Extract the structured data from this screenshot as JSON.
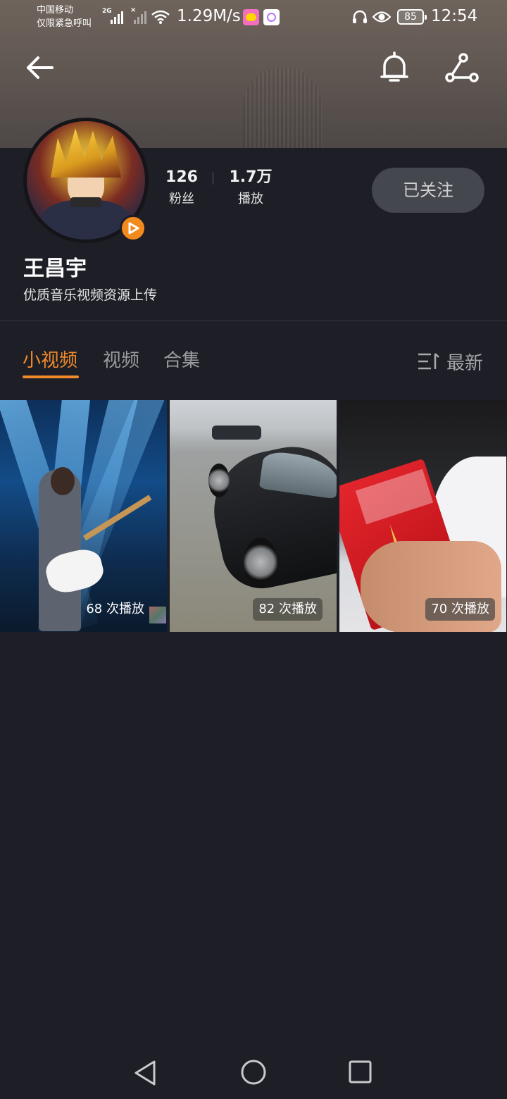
{
  "status_bar": {
    "carrier_line1": "中国移动",
    "carrier_line2": "仅限紧急呼叫",
    "network": "2G",
    "net_speed": "1.29M/s",
    "battery": "85",
    "time": "12:54"
  },
  "profile": {
    "fans_count": "126",
    "fans_label": "粉丝",
    "plays_count": "1.7万",
    "plays_label": "播放",
    "follow_button": "已关注",
    "username": "王昌宇",
    "bio": "优质音乐视频资源上传"
  },
  "tabs": [
    {
      "label": "小视频",
      "active": true
    },
    {
      "label": "视频",
      "active": false
    },
    {
      "label": "合集",
      "active": false
    }
  ],
  "sort": {
    "label": "最新"
  },
  "videos": [
    {
      "plays": "68 次播放"
    },
    {
      "plays": "82 次播放"
    },
    {
      "plays": "70 次播放"
    }
  ],
  "colors": {
    "accent": "#f08a2a",
    "background": "#1d1e26",
    "button_bg": "#45474f"
  },
  "icons": [
    "back-arrow-icon",
    "bell-icon",
    "share-icon",
    "play-badge-icon",
    "sort-icon",
    "nav-back-icon",
    "nav-home-icon",
    "nav-recents-icon"
  ]
}
